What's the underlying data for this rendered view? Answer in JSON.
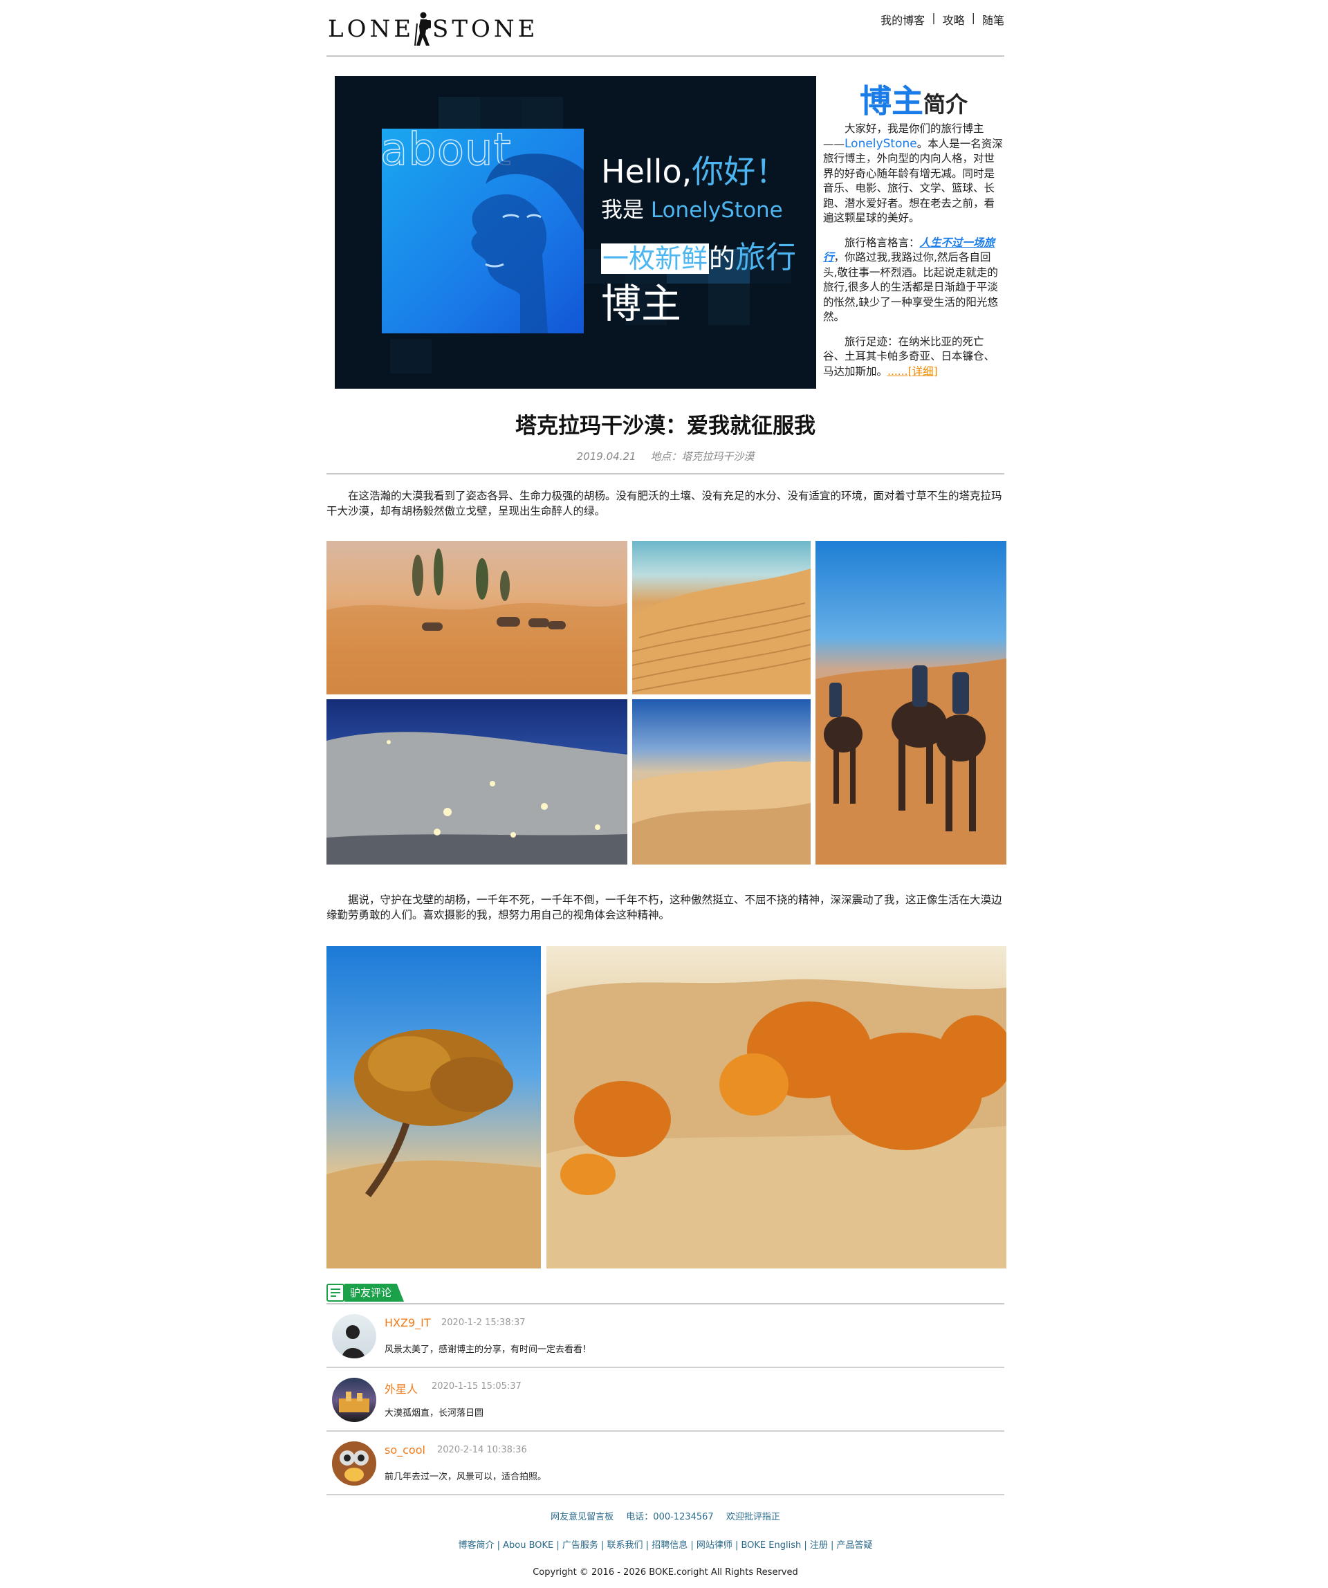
{
  "site": {
    "logo_left": "LONE",
    "logo_right": "STONE",
    "nav": [
      "我的博客",
      "攻略",
      "随笔"
    ]
  },
  "banner": {
    "about_word": "about",
    "hello": "Hello",
    "comma": ",",
    "nihao": "你好！",
    "line2_prefix": "我是",
    "line2_name": "LonelyStone",
    "line3_highlight": "一枚新鲜",
    "line3_mid": "的",
    "line3_blue": "旅行",
    "line4": "博主"
  },
  "about": {
    "title_big": "博主",
    "title_small": "简介",
    "p1_a": "大家好，我是你们的旅行博主——",
    "p1_name": "LonelyStone",
    "p1_b": "。本人是一名资深旅行博主，外向型的内向人格，对世界的好奇心随年龄有增无减。同时是音乐、电影、旅行、文学、篮球、长跑、潜水爱好者。想在老去之前，看遍这颗星球的美好。",
    "p2_a": "旅行格言格言：",
    "p2_motto": "人生不过一场旅行",
    "p2_b": "，你路过我,我路过你,然后各自回头,敬往事一杯烈酒。比起说走就走的旅行,很多人的生活都是日渐趋于平淡的怅然,缺少了一种享受生活的阳光悠然。",
    "p3_a": "旅行足迹：在纳米比亚的死亡谷、土耳其卡帕多奇亚、日本镰仓、马达加斯加。",
    "p3_detail": "......[详细]"
  },
  "article": {
    "title": "塔克拉玛干沙漠：爱我就征服我",
    "date": "2019.04.21",
    "location": "地点：塔克拉玛干沙漠",
    "para1": "在这浩瀚的大漠我看到了姿态各异、生命力极强的胡杨。没有肥沃的土壤、没有充足的水分、没有适宜的环境，面对着寸草不生的塔克拉玛干大沙漠，却有胡杨毅然傲立戈壁，呈现出生命醉人的绿。",
    "para2": "据说，守护在戈壁的胡杨，一千年不死，一千年不倒，一千年不朽，这种傲然挺立、不屈不挠的精神，深深震动了我，这正像生活在大漠边缘勤劳勇敢的人们。喜欢摄影的我，想努力用自己的视角体会这种精神。"
  },
  "comments": {
    "header": "驴友评论",
    "items": [
      {
        "name": "HXZ9_IT",
        "time": "2020-1-2 15:38:37",
        "text": "风景太美了，感谢博主的分享，有时间一定去看看！"
      },
      {
        "name": "外星人",
        "time": "2020-1-15 15:05:37",
        "text": "大漠孤烟直，长河落日圆"
      },
      {
        "name": "so_cool",
        "time": "2020-2-14 10:38:36",
        "text": "前几年去过一次，风景可以，适合拍照。"
      }
    ]
  },
  "footer": {
    "line1": [
      "网友意见留言板",
      "电话：000-1234567",
      "欢迎批评指正"
    ],
    "line2": "博客简介 | Abou BOKE | 广告服务 | 联系我们 | 招聘信息 | 网站律师 | BOKE English | 注册 | 产品答疑",
    "line3": "Copyright © 2016 - 2026 BOKE.coright All Rights Reserved"
  }
}
